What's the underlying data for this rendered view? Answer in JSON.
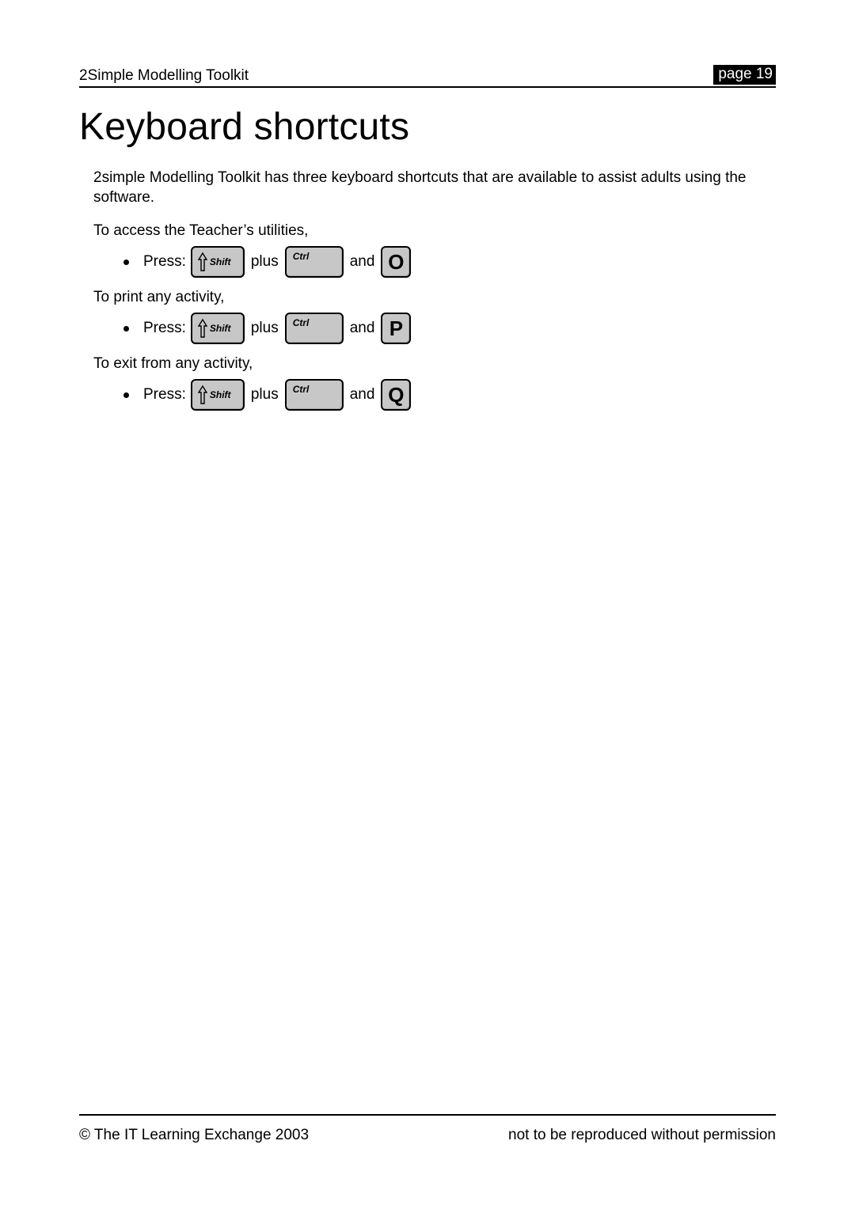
{
  "header": {
    "doc_title": "2Simple Modelling Toolkit",
    "page_label": "page 19"
  },
  "heading": "Keyboard shortcuts",
  "intro": "2simple Modelling Toolkit has three keyboard shortcuts that are available to assist adults using the software.",
  "connectors": {
    "press": "Press:",
    "plus": "plus",
    "and": "and"
  },
  "keys": {
    "shift": "Shift",
    "ctrl": "Ctrl"
  },
  "shortcuts": [
    {
      "label": "To access the Teacher’s utilities,",
      "letter": "O"
    },
    {
      "label": "To print any activity,",
      "letter": "P"
    },
    {
      "label": "To exit from any activity,",
      "letter": "Q"
    }
  ],
  "footer": {
    "left": "© The IT Learning Exchange 2003",
    "right": "not to be reproduced without permission"
  }
}
